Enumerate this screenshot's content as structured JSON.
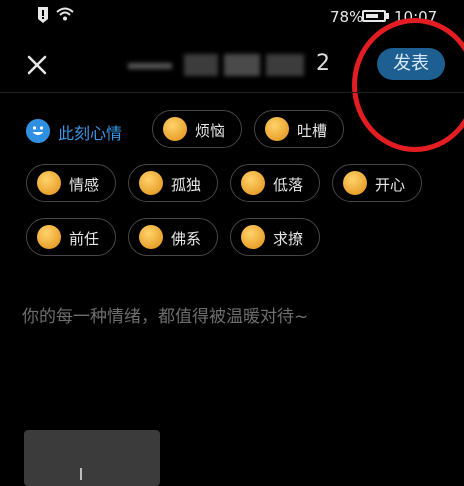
{
  "status": {
    "battery_text": "78%",
    "battery_level": 0.78,
    "time": "10:07"
  },
  "topbar": {
    "title_suffix": "2",
    "publish_label": "发表"
  },
  "mood": {
    "header_label": "此刻心情",
    "chips": [
      {
        "label": "烦恼",
        "emoji": "annoyed-face-icon"
      },
      {
        "label": "吐槽",
        "emoji": "ranting-face-icon"
      },
      {
        "label": "情感",
        "emoji": "emotional-face-icon"
      },
      {
        "label": "孤独",
        "emoji": "lonely-face-icon"
      },
      {
        "label": "低落",
        "emoji": "down-face-icon"
      },
      {
        "label": "开心",
        "emoji": "happy-sun-face-icon"
      },
      {
        "label": "前任",
        "emoji": "ex-cupcake-icon"
      },
      {
        "label": "佛系",
        "emoji": "zen-face-icon"
      },
      {
        "label": "求撩",
        "emoji": "flirty-face-icon"
      }
    ]
  },
  "editor": {
    "placeholder": "你的每一种情绪，都值得被温暖对待~"
  },
  "colors": {
    "accent": "#3b96e6",
    "publish_bg": "#1e5f92",
    "annotation": "#e41d23"
  }
}
